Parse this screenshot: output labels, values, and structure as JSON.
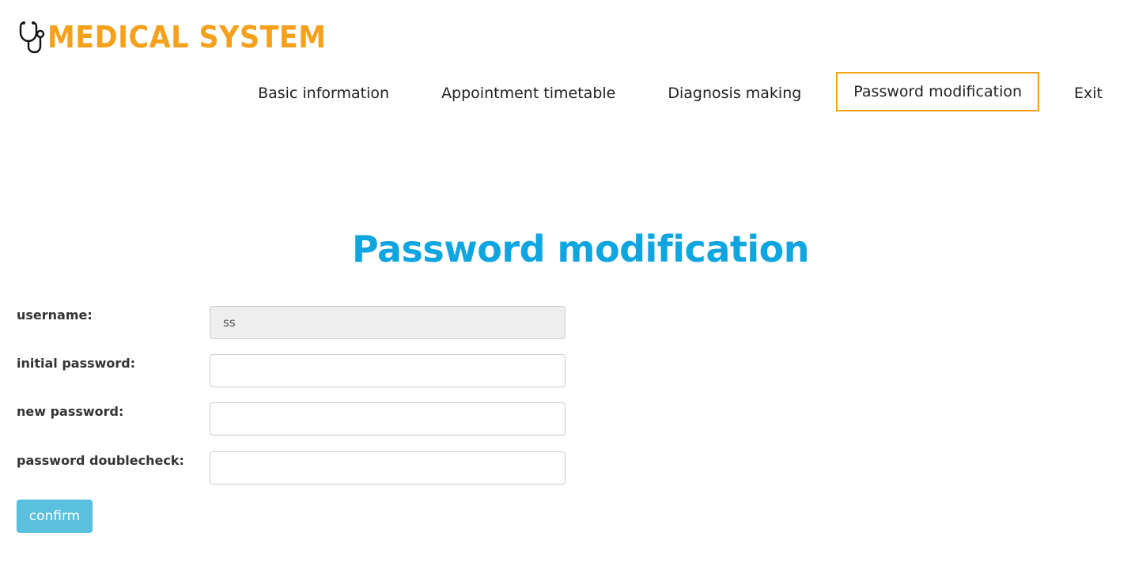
{
  "brand": {
    "name": "MEDICAL SYSTEM",
    "icon": "stethoscope-icon",
    "color": "#f5a11c"
  },
  "nav": {
    "items": [
      {
        "label": "Basic information",
        "active": false
      },
      {
        "label": "Appointment timetable",
        "active": false
      },
      {
        "label": "Diagnosis making",
        "active": false
      },
      {
        "label": "Password modification",
        "active": true
      },
      {
        "label": "Exit",
        "active": false
      }
    ],
    "active_border_color": "#f5a11c"
  },
  "page": {
    "title": "Password modification",
    "title_color": "#0ea5e0"
  },
  "form": {
    "username_label": "username:",
    "username_value": "ss",
    "initial_password_label": "initial password:",
    "initial_password_value": "",
    "new_password_label": "new password:",
    "new_password_value": "",
    "password_doublecheck_label": "password doublecheck:",
    "password_doublecheck_value": "",
    "confirm_label": "confirm",
    "confirm_color": "#5bc0de"
  }
}
